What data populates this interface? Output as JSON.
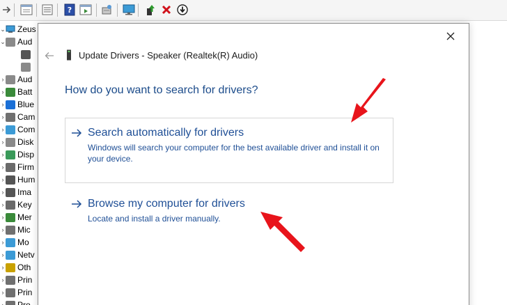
{
  "device_tree": {
    "computer_name": "Zeus",
    "items": [
      {
        "label": "Aud",
        "icon": "speaker-icon",
        "expand": "v",
        "color": "#8a8a8a"
      },
      {
        "label": "",
        "icon": "audio-endpoint-icon",
        "expand": "",
        "color": "#555555"
      },
      {
        "label": "",
        "icon": "speaker-small-icon",
        "expand": "",
        "color": "#8a8a8a"
      },
      {
        "label": "Aud",
        "icon": "speaker-icon",
        "expand": ">",
        "color": "#8a8a8a"
      },
      {
        "label": "Batt",
        "icon": "battery-icon",
        "expand": ">",
        "color": "#3a8a3a"
      },
      {
        "label": "Blue",
        "icon": "bluetooth-icon",
        "expand": ">",
        "color": "#1a6fd6"
      },
      {
        "label": "Cam",
        "icon": "camera-icon",
        "expand": ">",
        "color": "#707070"
      },
      {
        "label": "Com",
        "icon": "monitor-icon",
        "expand": ">",
        "color": "#3c9bd6"
      },
      {
        "label": "Disk",
        "icon": "disk-drive-icon",
        "expand": ">",
        "color": "#8a8a8a"
      },
      {
        "label": "Disp",
        "icon": "display-adapter-icon",
        "expand": ">",
        "color": "#3a9a5a"
      },
      {
        "label": "Firm",
        "icon": "firmware-icon",
        "expand": ">",
        "color": "#6a6a6a"
      },
      {
        "label": "Hum",
        "icon": "hid-icon",
        "expand": ">",
        "color": "#555555"
      },
      {
        "label": "Ima",
        "icon": "imaging-icon",
        "expand": ">",
        "color": "#555555"
      },
      {
        "label": "Key",
        "icon": "keyboard-icon",
        "expand": ">",
        "color": "#6a6a6a"
      },
      {
        "label": "Mer",
        "icon": "memory-icon",
        "expand": ">",
        "color": "#3a8a3a"
      },
      {
        "label": "Mic",
        "icon": "mouse-icon",
        "expand": ">",
        "color": "#707070"
      },
      {
        "label": "Mo",
        "icon": "monitor-icon",
        "expand": ">",
        "color": "#3c9bd6"
      },
      {
        "label": "Netv",
        "icon": "network-icon",
        "expand": ">",
        "color": "#3c9bd6"
      },
      {
        "label": "Oth",
        "icon": "unknown-device-icon",
        "expand": ">",
        "color": "#c9a100"
      },
      {
        "label": "Prin",
        "icon": "printer-icon",
        "expand": ">",
        "color": "#707070"
      },
      {
        "label": "Prin",
        "icon": "printer-icon",
        "expand": ">",
        "color": "#707070"
      },
      {
        "label": "Pro",
        "icon": "processor-icon",
        "expand": ">",
        "color": "#707070"
      }
    ]
  },
  "dialog": {
    "title": "Update Drivers - Speaker (Realtek(R) Audio)",
    "question": "How do you want to search for drivers?",
    "options": [
      {
        "heading": "Search automatically for drivers",
        "description": "Windows will search your computer for the best available driver and install it on your device."
      },
      {
        "heading": "Browse my computer for drivers",
        "description": "Locate and install a driver manually."
      }
    ]
  },
  "colors": {
    "link_blue": "#1f4f96",
    "annotation_red": "#e8141b"
  }
}
